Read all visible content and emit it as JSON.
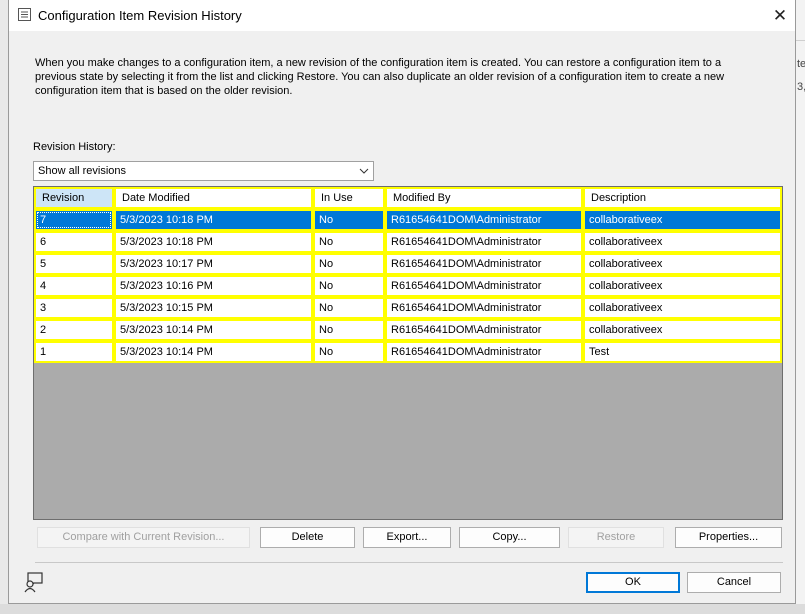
{
  "window": {
    "title": "Configuration Item Revision History",
    "close_glyph": "✕"
  },
  "intro_text": "When you make changes to a configuration item, a new revision of the configuration item is created. You can restore a configuration item to a previous state by selecting it from the list and clicking Restore. You can also duplicate an older revision of a configuration item to create a new configuration item that is based on the older revision.",
  "revision_history_label": "Revision History:",
  "filter_dropdown": {
    "selected": "Show all revisions"
  },
  "table": {
    "columns": [
      "Revision",
      "Date Modified",
      "In Use",
      "Modified By",
      "Description"
    ],
    "sorted_column": "Revision",
    "selected_row": 0,
    "rows": [
      [
        "7",
        "5/3/2023 10:18 PM",
        "No",
        "R61654641DOM\\Administrator",
        "collaborativeex"
      ],
      [
        "6",
        "5/3/2023 10:18 PM",
        "No",
        "R61654641DOM\\Administrator",
        "collaborativeex"
      ],
      [
        "5",
        "5/3/2023 10:17 PM",
        "No",
        "R61654641DOM\\Administrator",
        "collaborativeex"
      ],
      [
        "4",
        "5/3/2023 10:16 PM",
        "No",
        "R61654641DOM\\Administrator",
        "collaborativeex"
      ],
      [
        "3",
        "5/3/2023 10:15 PM",
        "No",
        "R61654641DOM\\Administrator",
        "collaborativeex"
      ],
      [
        "2",
        "5/3/2023 10:14 PM",
        "No",
        "R61654641DOM\\Administrator",
        "collaborativeex"
      ],
      [
        "1",
        "5/3/2023 10:14 PM",
        "No",
        "R61654641DOM\\Administrator",
        "Test"
      ]
    ]
  },
  "buttons": {
    "compare": "Compare with Current Revision...",
    "delete": "Delete",
    "export": "Export...",
    "copy": "Copy...",
    "restore": "Restore",
    "properties": "Properties...",
    "ok": "OK",
    "cancel": "Cancel"
  },
  "background_fragments": [
    "te",
    "3,"
  ],
  "colors": {
    "selection": "#0078d7",
    "cell_highlight_border": "#ffff00",
    "sorted_header": "#cde5f7",
    "grid_empty": "#ababab"
  },
  "icons": [
    "window-icon",
    "close-icon",
    "chevron-down-icon",
    "help-icon"
  ]
}
